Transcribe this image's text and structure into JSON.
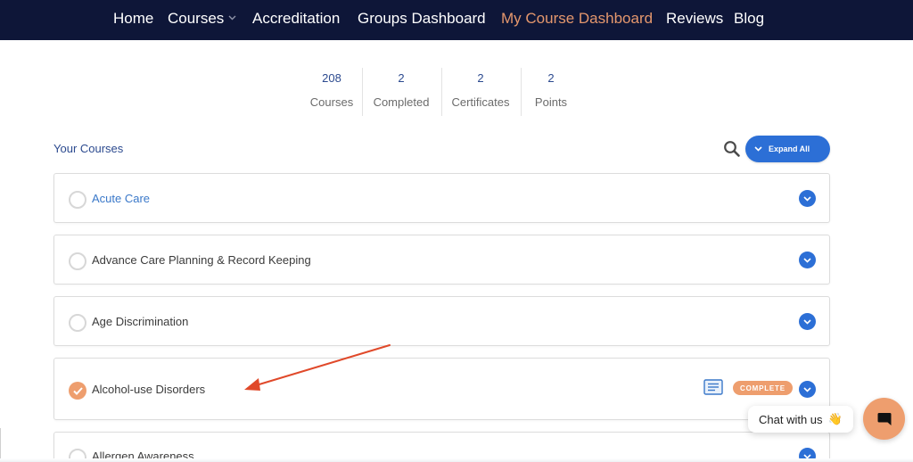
{
  "nav": {
    "items": [
      {
        "label": "Home",
        "active": false
      },
      {
        "label": "Courses",
        "active": false
      },
      {
        "label": "Accreditation",
        "active": false
      },
      {
        "label": "Groups Dashboard",
        "active": false
      },
      {
        "label": "My Course Dashboard",
        "active": true
      },
      {
        "label": "Reviews",
        "active": false
      },
      {
        "label": "Blog",
        "active": false
      }
    ]
  },
  "stats": [
    {
      "value": "208",
      "label": "Courses"
    },
    {
      "value": "2",
      "label": "Completed"
    },
    {
      "value": "2",
      "label": "Certificates"
    },
    {
      "value": "2",
      "label": "Points"
    }
  ],
  "courses_section": {
    "heading": "Your Courses",
    "search_icon": "search-icon",
    "expand_label": "Expand All"
  },
  "courses": [
    {
      "title": "Acute Care",
      "completed": false
    },
    {
      "title": "Advance Care Planning & Record Keeping",
      "completed": false
    },
    {
      "title": "Age Discrimination",
      "completed": false
    },
    {
      "title": "Alcohol-use Disorders",
      "completed": true,
      "badge": "COMPLETE",
      "certificate_icon": "certificate-icon"
    },
    {
      "title": "Allergen Awareness",
      "completed": false
    }
  ],
  "chat": {
    "bubble_text": "Chat with us",
    "emoji": "👋"
  },
  "colors": {
    "nav_bg": "#0e1638",
    "nav_active": "#e4976d",
    "accent_blue": "#2c6fd6",
    "complete_orange": "#ee9e6e",
    "annotation_red": "#e0492a"
  }
}
